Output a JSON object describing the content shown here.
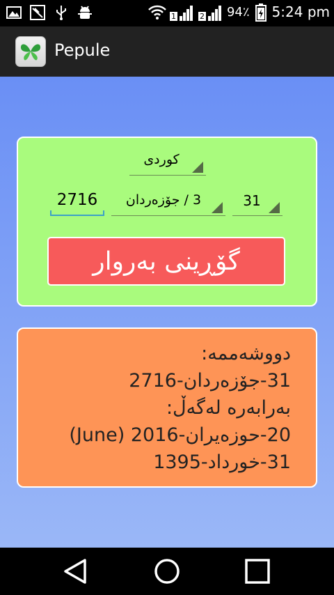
{
  "status_bar": {
    "sim1_label": "1",
    "sim2_label": "2",
    "battery": "94٪",
    "time": "5:24 pm"
  },
  "app_bar": {
    "title": "Pepule"
  },
  "converter": {
    "language": "کوردی",
    "year": "2716",
    "month": "3 / جۆزەردان",
    "day": "31",
    "convert_label": "گۆڕینی بەروار"
  },
  "result": {
    "lines": [
      "دووشەممە:",
      "31-جۆزەردان-2716",
      "بەرابەرە لەگەڵ:",
      "20-حوزەیران-2016 (June)",
      "31-خورداد-1395"
    ]
  },
  "colors": {
    "card_green": "#a9fb7d",
    "button_red": "#f75a5a",
    "card_orange": "#fe9456",
    "background_blue": "#7b9ff5"
  }
}
